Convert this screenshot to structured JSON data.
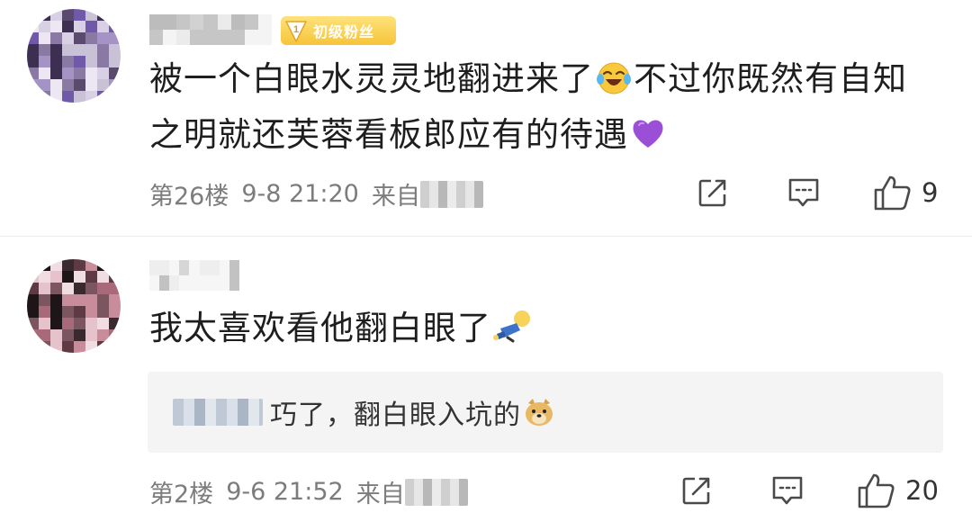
{
  "comments": [
    {
      "username_visible": false,
      "fan_badge": {
        "level": "1",
        "label": "初级粉丝"
      },
      "text_parts": [
        "被一个白眼水灵灵地翻进来了",
        "不过你既然有自知",
        "之明就还芙蓉看板郎应有的待遇"
      ],
      "emojis": [
        "laughing-crying-emoji",
        "purple-heart-emoji"
      ],
      "floor": "第26楼",
      "datetime": "9-8 21:20",
      "from_label": "来自",
      "likes": "9",
      "icons": {
        "share": "share-icon",
        "reply": "comment-icon",
        "like": "thumbs-up-icon"
      }
    },
    {
      "username_visible": false,
      "text": "我太喜欢看他翻白眼了",
      "emoji": "fainted-person-emoji",
      "reply": {
        "text": "巧了，翻白眼入坑的",
        "emoji": "doge-emoji"
      },
      "floor": "第2楼",
      "datetime": "9-6 21:52",
      "from_label": "来自",
      "likes": "20",
      "icons": {
        "share": "share-icon",
        "reply": "comment-icon",
        "like": "thumbs-up-icon"
      }
    }
  ],
  "colors": {
    "background": "#ffffff",
    "text": "#1e1e1e",
    "meta_text": "#7c7c7c",
    "fan_badge": "#f6c43a",
    "divider": "#ededed",
    "reply_bg": "#f4f4f4"
  }
}
